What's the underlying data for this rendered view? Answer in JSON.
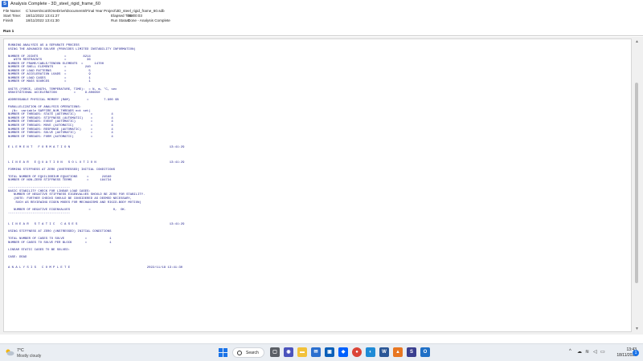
{
  "window": {
    "title": "Analysis Complete - 3D_steel_rigid_frame_60",
    "app_icon_letter": "S"
  },
  "info": {
    "file_name_label": "File Name:",
    "file_name": "C:\\Users\\scott\\OneDrive\\Documents\\Final Year Project\\3D_steel_rigid_frame_60.sdb",
    "start_time_label": "Start Time:",
    "start_time": "18/11/2022 13:41:27",
    "finish_label": "Finish",
    "finish_time": "18/11/2022 13:41:30",
    "elapsed_label": "Elapsed Time:",
    "elapsed_value": "00:00:03",
    "run_status_label": "Run Status:",
    "run_status_value": "Done - Analysis Complete"
  },
  "tabs": {
    "run": "Run 1"
  },
  "report": {
    "text": "RUNNING ANALYSIS AS A SEPARATE PROCESS\nUSING THE ADVANCED SOLVER (PROVIDES LIMITED INSTABILITY INFORMATION)\n\nNUMBER OF JOINTS              =         8214\n   WITH RESTRAINTS            =           36\nNUMBER OF FRAME/CABLE/TENDON ELEMENTS  =      14700\nNUMBER OF SHELL ELEMENTS      =          240\nNUMBER OF LOAD PATTERNS       =            5\nNUMBER OF ACCELERATION LOADS  =            9\nNUMBER OF LOAD CASES          =            1\nNUMBER OF MASS SOURCES        =            1\n\nUNITS (FORCE, LENGTH, TEMPERATURE, TIME):  = N, m, °C, sec\nGRAVITATIONAL ACCELERATION         =     9.806650\n\nADDRESSABLE PHYSICAL MEMORY (RAM)         =        7.900 GB\n\nPARALLELIZATION OF ANALYSIS OPERATIONS:\n  (N=  variable SAPFIRE_NUM_THREADS not set)\nNUMBER OF THREADS: STATE (AUTOMATIC)        =          4\nNUMBER OF THREADS: STIFFNESS (AUTOMATIC)    =          4\nNUMBER OF THREADS: EVENT (AUTOMATIC)        =          4\nNUMBER OF THREADS: MOVE (AUTOMATIC)         =          4\nNUMBER OF THREADS: RESPONSE (AUTOMATIC)     =          4\nNUMBER OF THREADS: SOLVE (AUTOMATIC)        =          4\nNUMBER OF THREADS: FORM (AUTOMATIC)         =          4\n\n\nE L E M E N T   F O R M A T I O N                                                     13:41:29\n\n\n\nL I N E A R   E Q U A T I O N   S O L U T I O N                                       13:41:29\n\nFORMING STIFFNESS AT ZERO (UNSTRESSED) INITIAL CONDITIONS\n\nTOTAL NUMBER OF EQUILIBRIUM EQUATIONS     =       24560\nNUMBER OF NON-ZERO STIFFNESS TERMS        =      184734\n\n---------------------------------\nBASIC STABILITY CHECK FOR LINEAR LOAD CASES:\n   NUMBER OF NEGATIVE STIFFNESS EIGENVALUES SHOULD BE ZERO FOR STABILITY.\n   (NOTE: FURTHER CHECKS SHOULD BE CONSIDERED AS DEEMED NECESSARY,\n    SUCH AS REVIEWING EIGEN MODES FOR MECHANISMS AND RIGID-BODY MOTION)\n\n   NUMBER OF NEGATIVE EIGENVALUES          =            0,  OK.\n---------------------------------\n\n\nL I N E A R   S T A T I C   C A S E S                                                 13:41:29\n\nUSING STIFFNESS AT ZERO (UNSTRESSED) INITIAL CONDITIONS\n\nTOTAL NUMBER OF CASES TO SOLVE           =            1\nNUMBER OF CASES TO SOLVE PER BLOCK       =            1\n\nLINEAR STATIC CASES TO BE SOLVED:\n\nCASE: DEAD\n\n\nA N A L Y S I S   C O M P L E T E                                         2022/11/18 13:41:30"
  },
  "taskbar": {
    "weather_temp": "7°C",
    "weather_desc": "Mostly cloudy",
    "search_label": "Search",
    "clock_time": "13:43",
    "clock_date": "18/11/2022",
    "notification_count": "1",
    "accent_color": "#1a73e8"
  }
}
